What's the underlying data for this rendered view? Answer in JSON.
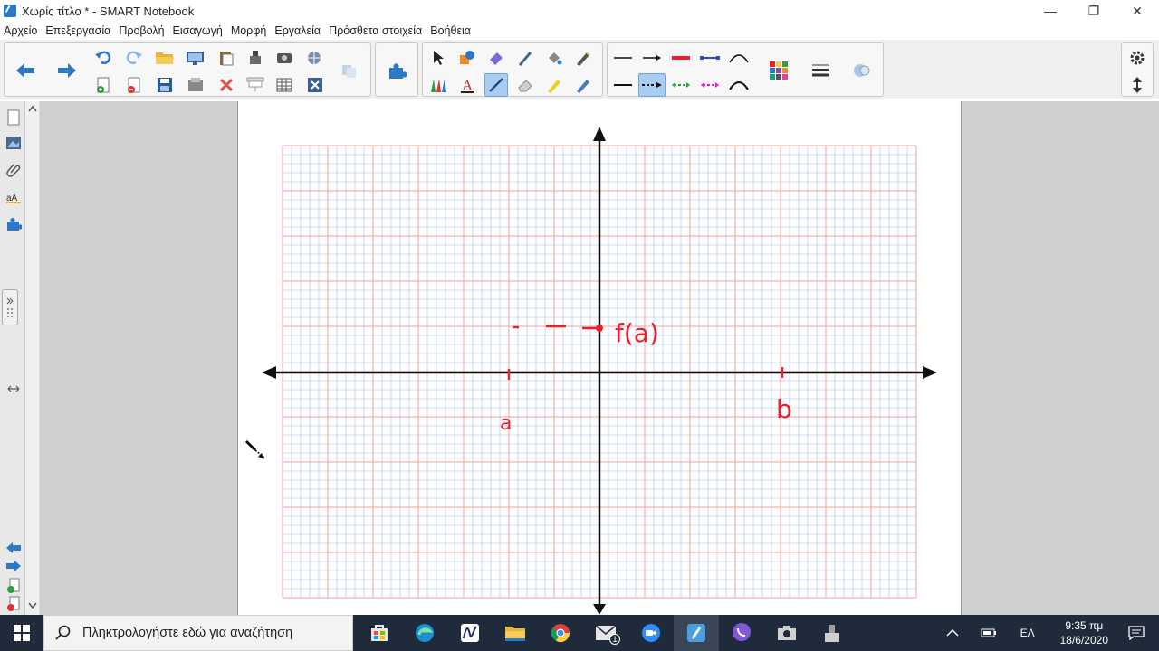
{
  "window": {
    "title": "Χωρίς τίτλο * - SMART Notebook",
    "minimize": "—",
    "restore": "❐",
    "close": "✕"
  },
  "menu": [
    "Αρχείο",
    "Επεξεργασία",
    "Προβολή",
    "Εισαγωγή",
    "Μορφή",
    "Εργαλεία",
    "Πρόσθετα στοιχεία",
    "Βοήθεια"
  ],
  "canvas": {
    "label_fa": "f(a)",
    "label_a": "a",
    "label_b": "b",
    "ink_color": "#e8202a"
  },
  "colors": {
    "accent": "#2b77c8",
    "grid_minor": "#a6bbe6",
    "grid_major": "#f0a0a0",
    "taskbar": "#1f2a3a"
  },
  "taskbar": {
    "search_placeholder": "Πληκτρολογήστε εδώ για αναζήτηση",
    "language": "ΕΛ",
    "time": "9:35 πμ",
    "date": "18/6/2020",
    "mail_badge": "1"
  }
}
